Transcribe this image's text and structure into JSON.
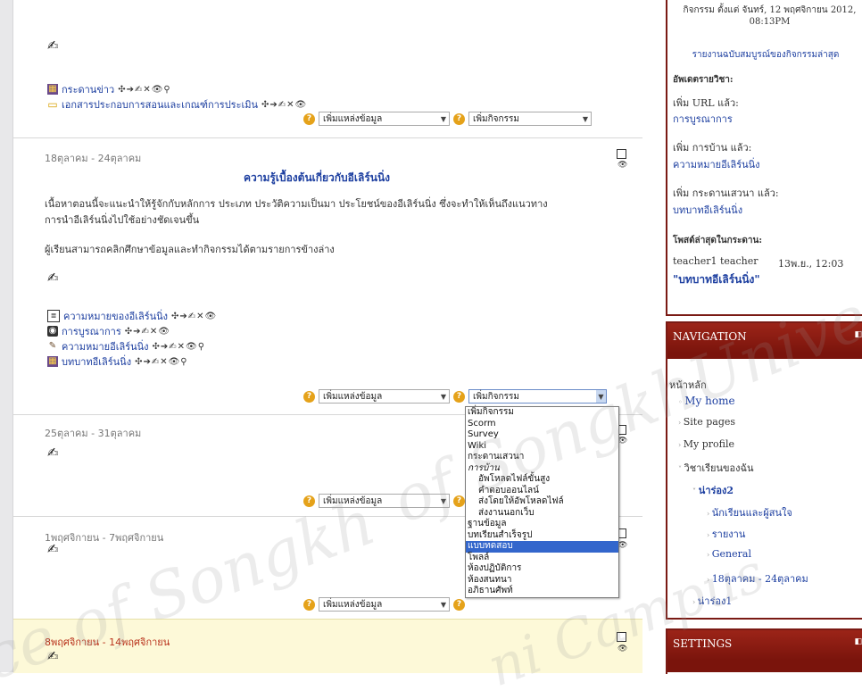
{
  "week_top": {
    "resources": [
      {
        "label": "กระดานข่าว",
        "icon": "forum-icon"
      },
      {
        "label": "เอกสารประกอบการสอนและเกณฑ์การประเมิน",
        "icon": "folder-icon"
      }
    ],
    "add_resource": "เพิ่มแหล่งข้อมูล",
    "add_activity": "เพิ่มกิจกรรม"
  },
  "week1": {
    "dates": "18ตุลาคม - 24ตุลาคม",
    "title": "ความรู้เบื้องต้นเกี่ยวกับอีเลิร์นนิ่ง",
    "para1": "เนื้อหาตอนนี้จะแนะนำให้รู้จักกับหลักการ ประเภท ประวัติความเป็นมา ประโยชน์ของอีเลิร์นนิ่ง ซึ่งจะทำให้เห็นถึงแนวทาง",
    "para1b": "การนำอีเลิร์นนิ่งไปใช้อย่างชัดเจนขึ้น",
    "para2": "ผู้เรียนสามารถคลิกศึกษาข้อมูลและทำกิจกรรมได้ตามรายการข้างล่าง",
    "resources": [
      {
        "label": "ความหมายของอีเลิร์นนิ่ง"
      },
      {
        "label": "การบูรณาการ"
      },
      {
        "label": "ความหมายอีเลิร์นนิ่ง"
      },
      {
        "label": "บทบาทอีเลิร์นนิ่ง"
      }
    ],
    "add_resource": "เพิ่มแหล่งข้อมูล",
    "add_activity": "เพิ่มกิจกรรม"
  },
  "week2": {
    "dates": "25ตุลาคม - 31ตุลาคม",
    "add_resource": "เพิ่มแหล่งข้อมูล"
  },
  "week3": {
    "dates": "1พฤศจิกายน - 7พฤศจิกายน",
    "add_resource": "เพิ่มแหล่งข้อมูล"
  },
  "week4": {
    "dates": "8พฤศจิกายน - 14พฤศจิกายน"
  },
  "activity_dropdown": [
    {
      "label": "เพิ่มกิจกรรม",
      "type": "item"
    },
    {
      "label": "Scorm",
      "type": "item"
    },
    {
      "label": "Survey",
      "type": "item"
    },
    {
      "label": "Wiki",
      "type": "item"
    },
    {
      "label": "กระดานเสวนา",
      "type": "item"
    },
    {
      "label": "การบ้าน",
      "type": "group"
    },
    {
      "label": "อัพโหลดไฟล์ขั้นสูง",
      "type": "sub"
    },
    {
      "label": "คำตอบออนไลน์",
      "type": "sub"
    },
    {
      "label": "ส่งโดยให้อัพโหลดไฟล์",
      "type": "sub"
    },
    {
      "label": "ส่งงานนอกเว็บ",
      "type": "sub"
    },
    {
      "label": "ฐานข้อมูล",
      "type": "item"
    },
    {
      "label": "บทเรียนสำเร็จรูป",
      "type": "item"
    },
    {
      "label": "แบบทดสอบ",
      "type": "selected"
    },
    {
      "label": "โพลล์",
      "type": "item"
    },
    {
      "label": "ห้องปฏิบัติการ",
      "type": "item"
    },
    {
      "label": "ห้องสนทนา",
      "type": "item"
    },
    {
      "label": "อภิธานศัพท์",
      "type": "item"
    }
  ],
  "recent": {
    "since_line1": "กิจกรรม ตั้งแต่ จันทร์, 12 พฤศจิกายน 2012,",
    "since_line2": "08:13PM",
    "full_report": "รายงานฉบับสมบูรณ์ของกิจกรรมล่าสุด",
    "course_updates": "อัพเดตรายวิชา:",
    "u1_action": "เพิ่ม URL แล้ว:",
    "u1_link": "การบูรณาการ",
    "u2_action": "เพิ่ม การบ้าน แล้ว:",
    "u2_link": "ความหมายอีเลิร์นนิ่ง",
    "u3_action": "เพิ่ม กระดานเสวนา แล้ว:",
    "u3_link": "บทบาทอีเลิร์นนิ่ง",
    "forum_posts": "โพสต์ล่าสุดในกระดาน:",
    "post_author": "teacher1 teacher",
    "post_date": "13พ.ย., 12:03",
    "post_title": "\"บทบาทอีเลิร์นนิ่ง\""
  },
  "navigation": {
    "title": "NAVIGATION",
    "home": "หน้าหลัก",
    "my_home": "My home",
    "site_pages": "Site pages",
    "my_profile": "My profile",
    "my_courses": "วิชาเรียนของฉัน",
    "course": "น่าร่อง2",
    "participants": "นักเรียนและผู้สนใจ",
    "reports": "รายงาน",
    "general": "General",
    "week": "18ตุลาคม - 24ตุลาคม",
    "course2": "น่าร่อง1"
  },
  "settings": {
    "title": "SETTINGS"
  },
  "watermark": {
    "line1": "of SongkhUniversi",
    "line2": "ce of Songkh",
    "line3": "ni Campus"
  }
}
